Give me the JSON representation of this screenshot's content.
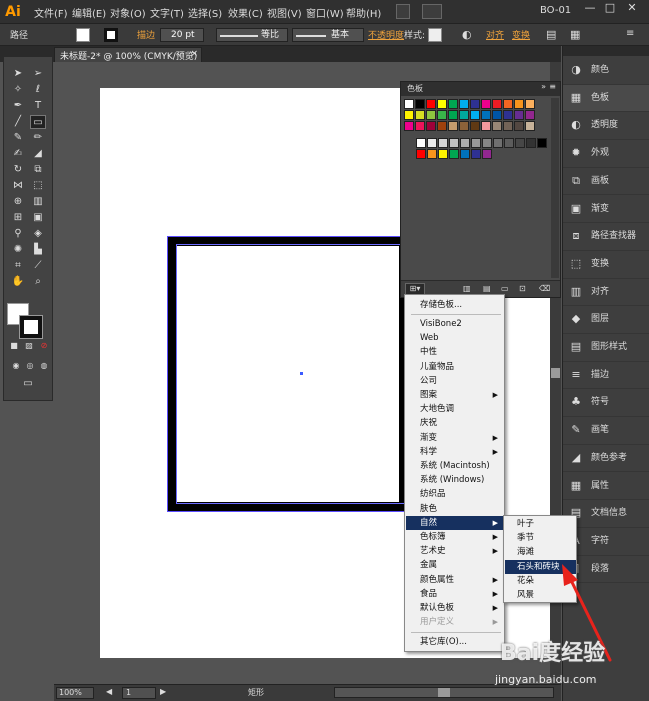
{
  "app": {
    "logo": "Ai",
    "workspace": "BO-01"
  },
  "menu": [
    "文件(F)",
    "编辑(E)",
    "对象(O)",
    "文字(T)",
    "选择(S)",
    "效果(C)",
    "视图(V)",
    "窗口(W)",
    "帮助(H)"
  ],
  "window_controls": [
    "—",
    "□",
    "✕"
  ],
  "control": {
    "object": "路径",
    "stroke_label": "描边",
    "stroke_weight": "20 pt",
    "profile": "等比",
    "brush": "基本",
    "opacity_label": "不透明度",
    "style_label": "样式:",
    "align_label": "对齐",
    "transform_label": "变换"
  },
  "document_tab": "未标题-2* @ 100% (CMYK/预览)",
  "status": {
    "zoom": "100%",
    "artboard": "1",
    "tool": "矩形"
  },
  "swatch_panel": {
    "title": "色板",
    "colors": {
      "row1": [
        "#ffffff",
        "#000000",
        "#ff0000",
        "#ffff00",
        "#00a651",
        "#00aeef",
        "#2e3192",
        "#ec008c",
        "#ed1c24",
        "#f26522",
        "#f7941d",
        "#fbaf5d"
      ],
      "row2": [
        "#fff200",
        "#d7df23",
        "#8dc63f",
        "#39b54a",
        "#00a651",
        "#00a99d",
        "#00aeef",
        "#0072bc",
        "#0054a6",
        "#2e3192",
        "#662d91",
        "#92278f"
      ],
      "row3": [
        "#ec008c",
        "#ed145b",
        "#9e0039",
        "#a0410d",
        "#c69c6d",
        "#8c6239",
        "#603913",
        "#f5989d",
        "#998675",
        "#736357",
        "#534741",
        "#c7b299"
      ],
      "row4": [
        "#ffffff",
        "#ebebeb",
        "#d6d6d6",
        "#c2c2c2",
        "#adadad",
        "#999999",
        "#858585",
        "#707070",
        "#5c5c5c",
        "#474747",
        "#333333",
        "#000000"
      ],
      "row5": [
        "#ff0000",
        "#f7941d",
        "#fff200",
        "#00a651",
        "#0072bc",
        "#2e3192",
        "#92278f"
      ]
    }
  },
  "library_menu": {
    "items": [
      "存储色板...",
      "VisiBone2",
      "Web",
      "中性",
      "儿童物品",
      "公司",
      "图案",
      "大地色调",
      "庆祝",
      "渐变",
      "科学",
      "系统 (Macintosh)",
      "系统 (Windows)",
      "纺织品",
      "肤色",
      "自然",
      "色标簿",
      "艺术史",
      "金属",
      "颜色属性",
      "食品",
      "默认色板",
      "用户定义",
      "其它库(O)..."
    ],
    "submenu": [
      "叶子",
      "季节",
      "海滩",
      "石头和砖块",
      "花朵",
      "风景"
    ]
  },
  "right_panel": [
    "颜色",
    "色板",
    "透明度",
    "外观",
    "画板",
    "渐变",
    "路径查找器",
    "变换",
    "对齐",
    "图层",
    "图形样式",
    "描边",
    "符号",
    "画笔",
    "颜色参考",
    "属性",
    "文档信息",
    "字符",
    "段落"
  ],
  "watermark": {
    "brand": "Bai度经验",
    "url": "jingyan.baidu.com"
  },
  "colors": {
    "accent": "#16305f",
    "annotation": "#e8231c"
  }
}
